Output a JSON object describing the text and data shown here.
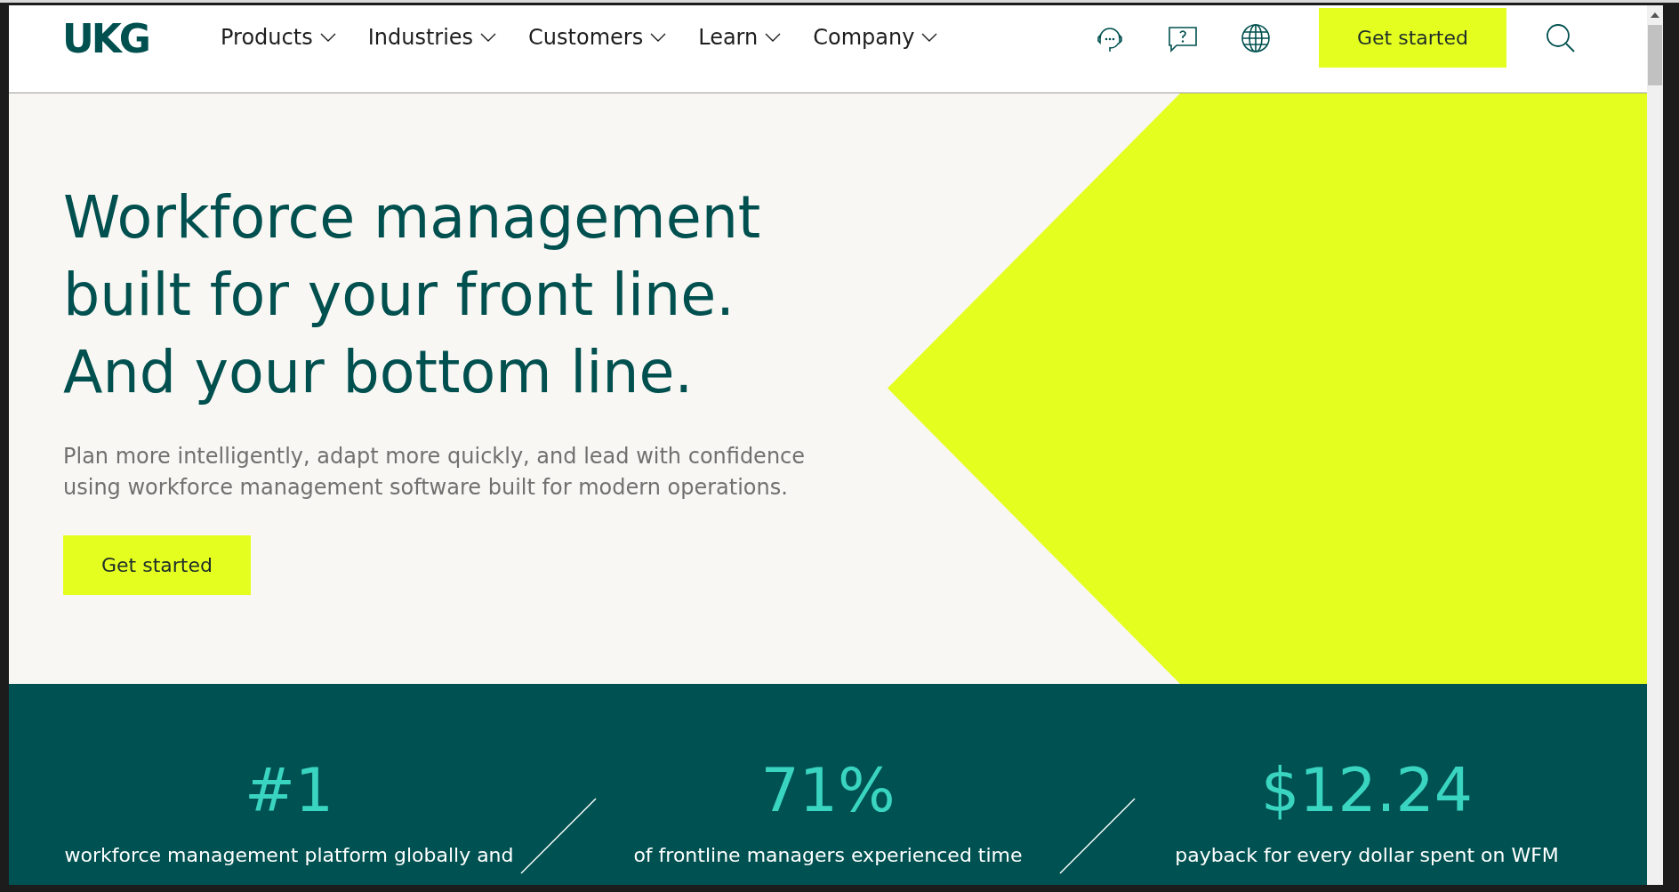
{
  "header": {
    "logo": "UKG",
    "nav": [
      {
        "label": "Products",
        "expanded": false
      },
      {
        "label": "Industries",
        "expanded": false
      },
      {
        "label": "Customers",
        "expanded": false
      },
      {
        "label": "Learn",
        "expanded": false
      },
      {
        "label": "Company",
        "expanded": false
      }
    ],
    "cta": "Get started"
  },
  "hero": {
    "headline": [
      "Workforce management",
      "built for your front line.",
      "And your bottom line."
    ],
    "subtitle": "Plan more intelligently, adapt more quickly, and lead with confidence using workforce management software built for modern operations.",
    "cta": "Get started"
  },
  "stats": [
    {
      "value": "#1",
      "lines": [
        "workforce management platform globally and"
      ]
    },
    {
      "value": "71%",
      "lines": [
        "of frontline managers experienced time"
      ]
    },
    {
      "value": "$12.24",
      "lines": [
        "payback for every dollar spent on WFM"
      ]
    }
  ]
}
